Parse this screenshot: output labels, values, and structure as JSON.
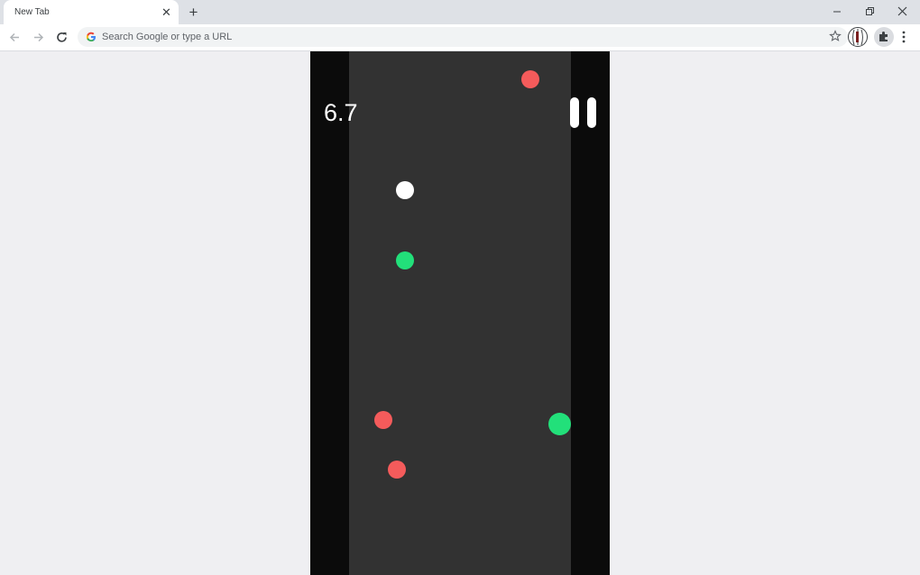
{
  "browser": {
    "tab_title": "New Tab",
    "tab_close": "✕",
    "new_tab": "+",
    "omnibox_placeholder": "Search Google or type a URL"
  },
  "game": {
    "score": "6.7",
    "colors": {
      "background": "#0b0b0b",
      "track": "#323232",
      "hazard": "#f45b5b",
      "bonus": "#22e07a",
      "player": "#ffffff"
    },
    "icons": [
      "pause-icon"
    ]
  }
}
